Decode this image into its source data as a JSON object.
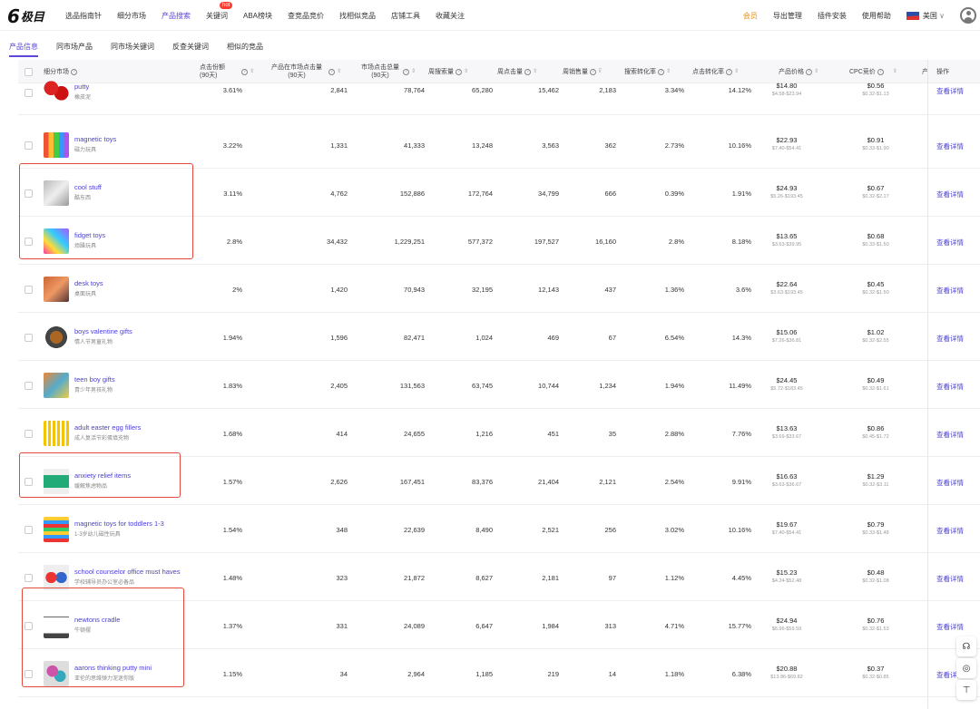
{
  "logo": {
    "mark": "6",
    "text": "极目"
  },
  "nav": {
    "items": [
      "选品指南针",
      "细分市场",
      "产品搜索",
      "关键词",
      "ABA榜块",
      "查竞品竞价",
      "找相似竞品",
      "店铺工具",
      "收藏关注"
    ],
    "active_index": 2,
    "hot_badge": "hot"
  },
  "right_nav": {
    "vip": "会员",
    "export": "导出管理",
    "plugin": "插件安装",
    "help": "使用帮助",
    "country": "美国",
    "chevron": "∨"
  },
  "subtabs": {
    "items": [
      "产品信息",
      "同市场产品",
      "同市场关键词",
      "反查关键词",
      "相似的竞品"
    ],
    "active_index": 0
  },
  "columns": {
    "market": "细分市场",
    "click_share": "点击份额",
    "click_share_sub": "(90天)",
    "prod_clicks": "产品在市场点击量",
    "prod_clicks_sub": "(90天)",
    "market_clicks": "市场点击总量",
    "market_clicks_sub": "(90天)",
    "weekly_search": "周搜索量",
    "weekly_clicks": "周点击量",
    "weekly_sales": "周销售量",
    "search_conv": "搜索转化率",
    "ctr": "点击转化率",
    "price": "产品价格",
    "cpc": "CPC竞价",
    "prod": "产",
    "action": "操作"
  },
  "rows": [
    {
      "en": "putty",
      "cn": "橡皮泥",
      "share": "3.61%",
      "pclicks": "2,841",
      "mclicks": "78,764",
      "search": "65,280",
      "clicks": "15,462",
      "sales": "2,183",
      "sconv": "3.34%",
      "cconv": "14.12%",
      "price": "$14.80",
      "price_range": "$4.58-$23.94",
      "cpc": "$0.56",
      "cpc_range": "$0.32-$1.13",
      "action": "查看详情"
    },
    {
      "en": "magnetic toys",
      "cn": "磁力玩具",
      "share": "3.22%",
      "pclicks": "1,331",
      "mclicks": "41,333",
      "search": "13,248",
      "clicks": "3,563",
      "sales": "362",
      "sconv": "2.73%",
      "cconv": "10.16%",
      "price": "$22.93",
      "price_range": "$7.40-$54.41",
      "cpc": "$0.91",
      "cpc_range": "$0.33-$1.90",
      "action": "查看详情"
    },
    {
      "en": "cool stuff",
      "cn": "酷东西",
      "share": "3.11%",
      "pclicks": "4,762",
      "mclicks": "152,886",
      "search": "172,764",
      "clicks": "34,799",
      "sales": "666",
      "sconv": "0.39%",
      "cconv": "1.91%",
      "price": "$24.93",
      "price_range": "$5.26-$193.45",
      "cpc": "$0.67",
      "cpc_range": "$0.32-$2.17",
      "action": "查看详情"
    },
    {
      "en": "fidget toys",
      "cn": "烦躁玩具",
      "share": "2.8%",
      "pclicks": "34,432",
      "mclicks": "1,229,251",
      "search": "577,372",
      "clicks": "197,527",
      "sales": "16,160",
      "sconv": "2.8%",
      "cconv": "8.18%",
      "price": "$13.65",
      "price_range": "$3.63-$39.95",
      "cpc": "$0.68",
      "cpc_range": "$0.33-$1.50",
      "action": "查看详情"
    },
    {
      "en": "desk toys",
      "cn": "桌面玩具",
      "share": "2%",
      "pclicks": "1,420",
      "mclicks": "70,943",
      "search": "32,195",
      "clicks": "12,143",
      "sales": "437",
      "sconv": "1.36%",
      "cconv": "3.6%",
      "price": "$22.64",
      "price_range": "$3.63-$193.45",
      "cpc": "$0.45",
      "cpc_range": "$0.32-$1.50",
      "action": "查看详情"
    },
    {
      "en": "boys valentine gifts",
      "cn": "情人节男童礼物",
      "share": "1.94%",
      "pclicks": "1,596",
      "mclicks": "82,471",
      "search": "1,024",
      "clicks": "469",
      "sales": "67",
      "sconv": "6.54%",
      "cconv": "14.3%",
      "price": "$15.06",
      "price_range": "$7.26-$36.81",
      "cpc": "$1.02",
      "cpc_range": "$0.32-$2.55",
      "action": "查看详情"
    },
    {
      "en": "teen boy gifts",
      "cn": "青少年男孩礼物",
      "share": "1.83%",
      "pclicks": "2,405",
      "mclicks": "131,563",
      "search": "63,745",
      "clicks": "10,744",
      "sales": "1,234",
      "sconv": "1.94%",
      "cconv": "11.49%",
      "price": "$24.45",
      "price_range": "$5.72-$183.45",
      "cpc": "$0.49",
      "cpc_range": "$0.32-$1.61",
      "action": "查看详情"
    },
    {
      "en": "adult easter egg fillers",
      "cn": "成人复活节彩蛋填充物",
      "share": "1.68%",
      "pclicks": "414",
      "mclicks": "24,655",
      "search": "1,216",
      "clicks": "451",
      "sales": "35",
      "sconv": "2.88%",
      "cconv": "7.76%",
      "price": "$13.63",
      "price_range": "$3.69-$33.67",
      "cpc": "$0.86",
      "cpc_range": "$0.45-$1.72",
      "action": "查看详情"
    },
    {
      "en": "anxiety relief items",
      "cn": "缓解焦虑物品",
      "share": "1.57%",
      "pclicks": "2,626",
      "mclicks": "167,451",
      "search": "83,376",
      "clicks": "21,404",
      "sales": "2,121",
      "sconv": "2.54%",
      "cconv": "9.91%",
      "price": "$16.63",
      "price_range": "$3.63-$36.67",
      "cpc": "$1.29",
      "cpc_range": "$0.32-$3.11",
      "action": "查看详情"
    },
    {
      "en": "magnetic toys for toddlers 1-3",
      "cn": "1-3岁幼儿磁性玩具",
      "share": "1.54%",
      "pclicks": "348",
      "mclicks": "22,639",
      "search": "8,490",
      "clicks": "2,521",
      "sales": "256",
      "sconv": "3.02%",
      "cconv": "10.16%",
      "price": "$19.67",
      "price_range": "$7.40-$54.41",
      "cpc": "$0.79",
      "cpc_range": "$0.33-$1.48",
      "action": "查看详情"
    },
    {
      "en": "school counselor office must haves",
      "cn": "学校辅导员办公室必备品",
      "share": "1.48%",
      "pclicks": "323",
      "mclicks": "21,872",
      "search": "8,627",
      "clicks": "2,181",
      "sales": "97",
      "sconv": "1.12%",
      "cconv": "4.45%",
      "price": "$15.23",
      "price_range": "$4.24-$52.48",
      "cpc": "$0.48",
      "cpc_range": "$0.32-$1.08",
      "action": "查看详情"
    },
    {
      "en": "newtons cradle",
      "cn": "牛顿摆",
      "share": "1.37%",
      "pclicks": "331",
      "mclicks": "24,089",
      "search": "6,647",
      "clicks": "1,984",
      "sales": "313",
      "sconv": "4.71%",
      "cconv": "15.77%",
      "price": "$24.94",
      "price_range": "$6.96-$59.59",
      "cpc": "$0.76",
      "cpc_range": "$0.32-$1.53",
      "action": "查看详情"
    },
    {
      "en": "aarons thinking putty mini",
      "cn": "亚伦的思维弹力泥迷你版",
      "share": "1.15%",
      "pclicks": "34",
      "mclicks": "2,964",
      "search": "1,185",
      "clicks": "219",
      "sales": "14",
      "sconv": "1.18%",
      "cconv": "6.38%",
      "price": "$20.88",
      "price_range": "$13.86-$69.82",
      "cpc": "$0.37",
      "cpc_range": "$0.32-$0.85",
      "action": "查看详情"
    }
  ],
  "colors": {
    "accent": "#5b48d9",
    "link": "#4a3fd6",
    "highlight_box": "#e24a3b",
    "vip": "#e98b14"
  }
}
